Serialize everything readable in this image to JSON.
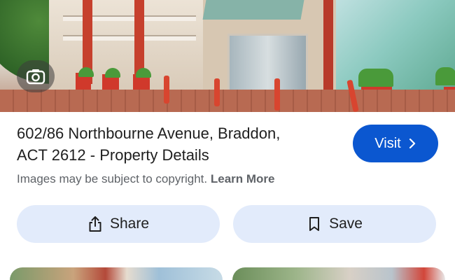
{
  "hero": {
    "camera_icon": "lens-camera-icon"
  },
  "result": {
    "title_line1": "602/86 Northbourne Avenue, Braddon,",
    "title_line2": "ACT 2612 - Property Details",
    "visit_label": "Visit",
    "visit_icon": "chevron-right-icon",
    "copyright_text": "Images may be subject to copyright.",
    "learn_more_label": "Learn More"
  },
  "actions": {
    "share_label": "Share",
    "share_icon": "share-icon",
    "save_label": "Save",
    "save_icon": "bookmark-icon"
  },
  "colors": {
    "visit_bg": "#0b57d0",
    "action_bg": "#e2ebfb",
    "text_primary": "#1f1f1f",
    "text_secondary": "#5f6368"
  }
}
